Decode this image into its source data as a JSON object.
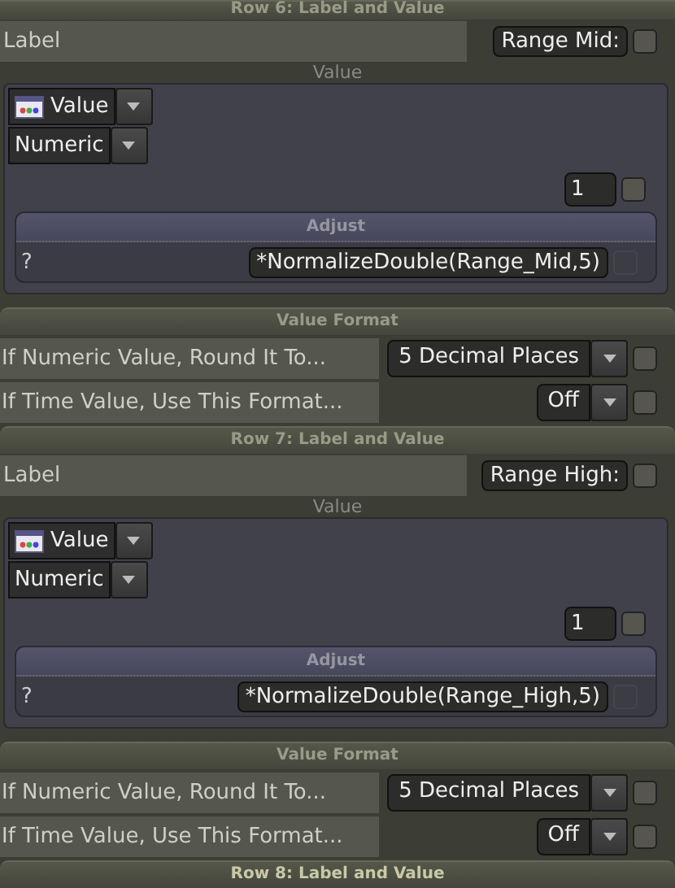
{
  "sections": [
    {
      "kind": "row",
      "header": "Row 6: Label and Value",
      "label": {
        "caption": "Label",
        "value": "Range Mid:",
        "checked": false
      },
      "value_caption": "Value",
      "value_type": "Value",
      "value_kind": "Numeric",
      "count": {
        "value": "1",
        "checked": false
      },
      "adjust": {
        "title": "Adjust",
        "prefix": "?",
        "expression": "*NormalizeDouble(Range_Mid,5)",
        "checked": false,
        "disabled": true
      },
      "format": {
        "title": "Value Format",
        "rows": [
          {
            "label": "If Numeric Value, Round It To...",
            "value": "5 Decimal Places",
            "checked": false
          },
          {
            "label": "If Time Value, Use This Format...",
            "value": "Off",
            "checked": false
          }
        ]
      }
    },
    {
      "kind": "row",
      "header": "Row 7: Label and Value",
      "label": {
        "caption": "Label",
        "value": "Range High:",
        "checked": false
      },
      "value_caption": "Value",
      "value_type": "Value",
      "value_kind": "Numeric",
      "count": {
        "value": "1",
        "checked": false
      },
      "adjust": {
        "title": "Adjust",
        "prefix": "?",
        "expression": "*NormalizeDouble(Range_High,5)",
        "checked": false,
        "disabled": true
      },
      "format": {
        "title": "Value Format",
        "rows": [
          {
            "label": "If Numeric Value, Round It To...",
            "value": "5 Decimal Places",
            "checked": false
          },
          {
            "label": "If Time Value, Use This Format...",
            "value": "Off",
            "checked": false
          }
        ]
      }
    },
    {
      "kind": "header",
      "header": "Row 8: Label and Value"
    }
  ]
}
